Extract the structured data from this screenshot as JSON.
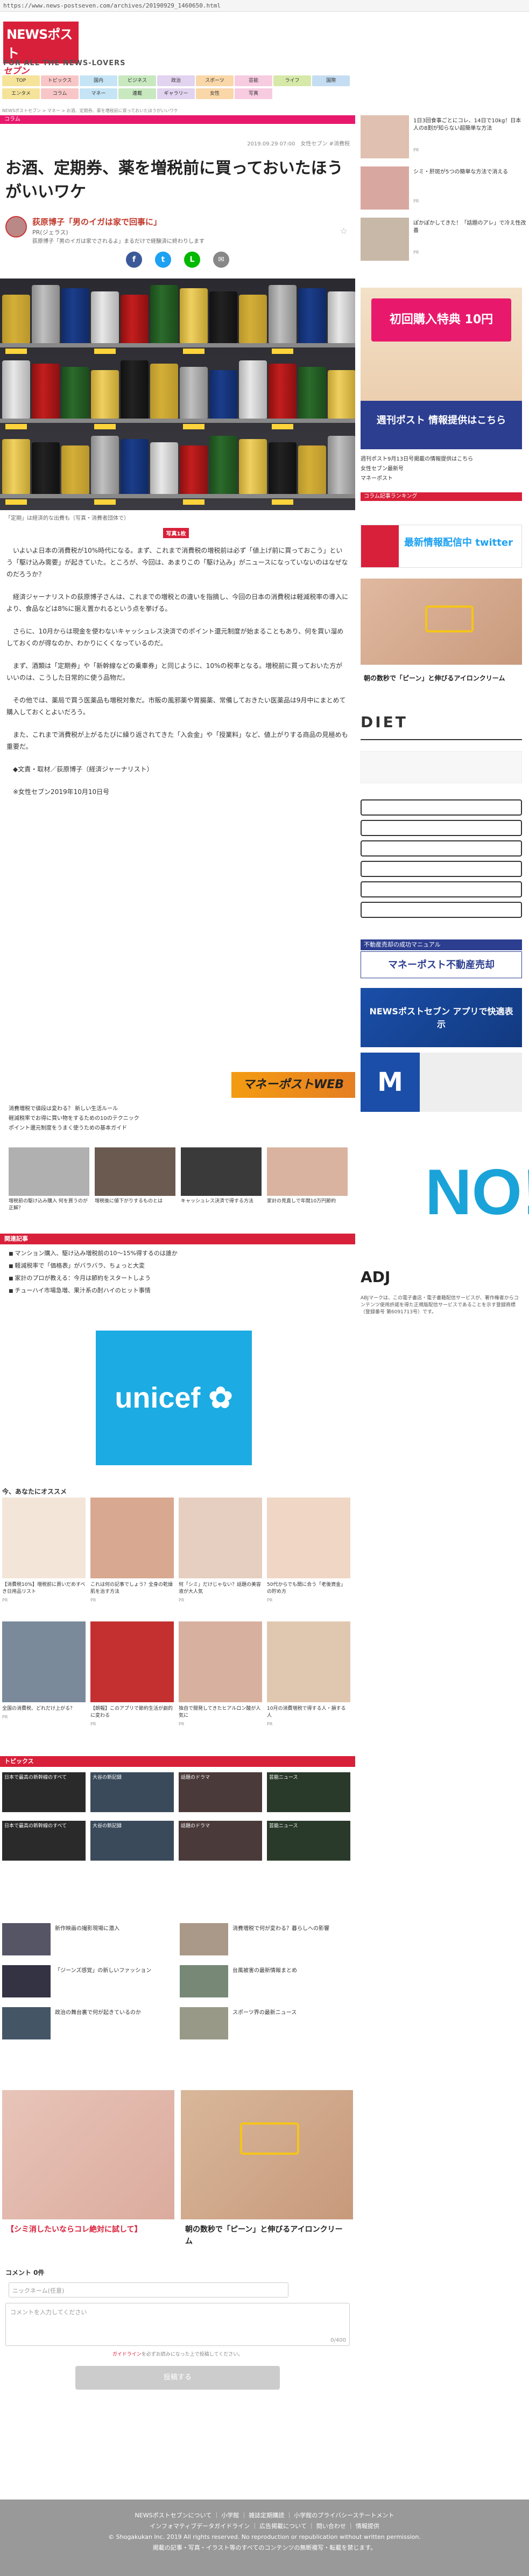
{
  "url": "https://www.news-postseven.com/archives/20190929_1460650.html",
  "logo": {
    "main": "NEWSポスト",
    "sub": "セブン"
  },
  "tagline": "FOR ALL THE NEWS-LOVERS",
  "nav": [
    "TOP",
    "トピックス",
    "国内",
    "ビジネス",
    "政治",
    "スポーツ",
    "芸能",
    "ライフ",
    "国際",
    "エンタメ",
    "コラム",
    "マネー",
    "連載",
    "ギャラリー",
    "女性",
    "写真"
  ],
  "breadcrumb": "NEWSポストセブン > マネー > お酒、定期券、薬を増税前に買っておいたほうがいいワケ",
  "category": "コラム",
  "date": "2019.09.29 07:00　女性セブン #消費税",
  "title": "お酒、定期券、薬を増税前に買っておいたほうがいいワケ",
  "author": {
    "name": "荻原博子「男のイガは家で回事に」",
    "pr": "PR(ジェラス)",
    "desc": "荻原博子「男のイガは家でされるよ」まるだけで経験済に終わりします"
  },
  "share": [
    "f",
    "t",
    "L",
    "✉"
  ],
  "photo_caption": "「定期」は経済的な出費も（写真・消費者団体で）",
  "photo_count": {
    "badge": "写真1枚",
    "label": ""
  },
  "body": [
    "いよいよ日本の消費税が10%時代になる。まず、これまで消費税の増税前は必ず「値上げ前に買っておこう」という「駆け込み需要」が起きていた。ところが、今回は、あまりこの「駆け込み」がニュースになっていないのはなぜなのだろうか？",
    "経済ジャーナリストの荻原博子さんは、これまでの増税との違いを指摘し、今回の日本の消費税は軽減税率の導入により、食品などは8%に据え置かれるという点を挙げる。",
    "さらに、10月からは現金を使わないキャッシュレス決済でのポイント還元制度が始まることもあり、何を買い溜めしておくのが得なのか、わかりにくくなっているのだ。",
    "まず、酒類は「定期券」や「新幹線などの乗車券」と同じように、10%の税率となる。増税前に買っておいた方がいいのは、こうした日常的に使う品物だ。",
    "その他では、薬局で買う医薬品も増税対象だ。市販の風邪薬や胃腸薬、常備しておきたい医薬品は9月中にまとめて購入しておくとよいだろう。",
    "また、これまで消費税が上がるたびに繰り返されてきた「入会金」や「授業料」など、値上がりする商品の見極めも重要だ。",
    "◆文責・取材／荻原博子（経済ジャーナリスト）",
    "※女性セブン2019年10月10日号"
  ],
  "mpw_logo": "マネーポストWEB",
  "mpw_links": [
    "消費増税で値段は変わる？ 新しい生活ルール",
    "軽減税率でお得に買い物をするための10のテクニック",
    "ポイント還元制度をうまく使うための基本ガイド"
  ],
  "mpw_thumbs": [
    "増税前の駆け込み購入 何を買うのが正解？",
    "増税後に値下がりするものとは",
    "キャッシュレス決済で得する方法",
    "家計の見直しで年間10万円節約"
  ],
  "related_head": "関連記事",
  "related": [
    "マンション購入、駆け込み増税前の10〜15%得するのは誰か",
    "軽減税率で「価格表」がバラバラ、ちょっと大変",
    "家計のプロが教える：今月は節約をスタートしよう",
    "チューハイ市場急増、果汁系の酎ハイのヒット事情"
  ],
  "recommend_title": "今、あなたにオススメ",
  "recommend": [
    {
      "t": "【消費税10%】増税前に買いだめすべき日用品リスト",
      "s": "PR"
    },
    {
      "t": "これは何の記事でしょう？全身の乾燥肌を治す方法",
      "s": "PR"
    },
    {
      "t": "何「シミ」だけじゃない？話題の美容液が大人気",
      "s": "PR"
    },
    {
      "t": "50代からでも間に合う「老後資金」の貯め方",
      "s": "PR"
    },
    {
      "t": "全国の消費税、どれだけ上がる？",
      "s": "PR"
    },
    {
      "t": "【朗報】このアプリで節約生活が劇的に変わる",
      "s": "PR"
    },
    {
      "t": "独自で開発してきたヒアルロン酸が人気に",
      "s": "PR"
    },
    {
      "t": "10月の消費増税で得する人・損する人",
      "s": "PR"
    }
  ],
  "topics_head": "トピックス",
  "topics": [
    "日本で最高の新幹線のすべて",
    "大谷の新記録",
    "話題のドラマ",
    "芸能ニュース"
  ],
  "topics2": [
    "新作映画の撮影現場に潜入",
    "消費増税で何が変わる？暮らしへの影響",
    "「ジーンズ感覚」の新しいファッション",
    "台風被害の最新情報まとめ",
    "政治の舞台裏で何が起きているのか",
    "スポーツ界の最新ニュース"
  ],
  "comment": {
    "title": "コメント 0件",
    "name_placeholder": "ニックネーム(任意)",
    "text_placeholder": "コメントを入力してください",
    "count": "0/400",
    "guide_prefix": "",
    "guide_link": "ガイドライン",
    "guide_suffix": "を必ずお読みになった上で投稿してください。",
    "submit": "投稿する"
  },
  "sidebar": {
    "thumbs": [
      {
        "t": "1日3回食事ごとにコレ、14日で10kg！日本人の8割が知らない超簡単な方法",
        "s": "PR"
      },
      {
        "t": "シミ・肝斑が5つの簡単な方法で消える",
        "s": "PR"
      },
      {
        "t": "ぽかぽかしてきた！「話題のアレ」で冷え性改善",
        "s": "PR"
      }
    ],
    "ad_text": "初回購入特典 10円",
    "ad_sub": "週刊ポスト 情報提供はこちら",
    "links": [
      "週刊ポスト9月13日号掲載の情報提供はこちら",
      "女性セブン最新号",
      "マネーポスト"
    ],
    "head": "コラム記事ランキング",
    "twitter": "最新情報配信中 twitter",
    "diet": "DIET",
    "mpf_head": "不動産売却の成功マニュアル",
    "mpf": "マネーポスト不動産売却",
    "app": "NEWSポストセブン アプリで快適表示",
    "no": "NO!",
    "adj": "ADJ",
    "adj_desc": "ABJマークは、この電子書店・電子書籍配信サービスが、著作権者からコンテンツ使用許諾を得た正規版配信サービスであることを示す登録商標（登録番号 第6091713号）です。"
  },
  "footer": [
    "NEWSポストセブンについて ｜ 小学館 ｜ 雑誌定期購読 ｜ 小学館のプライバシーステートメント",
    "インフォマティブデータガイドライン ｜ 広告掲載について ｜ 問い合わせ ｜ 情報提供",
    "© Shogakukan Inc. 2019 All rights reserved. No reproduction or republication without written permission.",
    "掲載の記事・写真・イラスト等のすべてのコンテンツの無断複写・転載を禁じます。"
  ],
  "colors": {
    "brand": "#d8203a",
    "pink": "#e8196c"
  }
}
